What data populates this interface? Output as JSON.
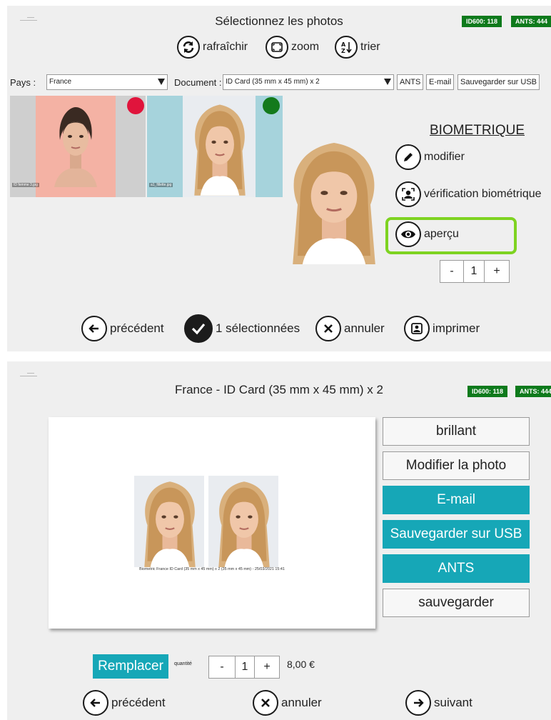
{
  "screen1": {
    "title": "Sélectionnez les photos",
    "badges": [
      "ID600: 118",
      "ANTS: 444"
    ],
    "toolbar": {
      "refresh": "rafraîchir",
      "zoom": "zoom",
      "sort": "trier"
    },
    "country": {
      "label": "Pays :",
      "value": "France"
    },
    "document": {
      "label": "Document :",
      "value": "ID Card (35 mm x 45 mm) x 2"
    },
    "actions": [
      "ANTS",
      "E-mail",
      "Sauvegarder sur USB"
    ],
    "thumbnails": [
      {
        "filename": "ID femme 3.jpg",
        "status_color": "#e0143c"
      },
      {
        "filename": "a1_fillette.jpg",
        "status_color": "#137a1c"
      }
    ],
    "biometric": {
      "title": "BIOMETRIQUE",
      "edit": "modifier",
      "check": "vérification biométrique",
      "preview": "aperçu"
    },
    "quantity": {
      "minus": "-",
      "value": "1",
      "plus": "+"
    },
    "bottom": {
      "previous": "précédent",
      "selected": "1 sélectionnées",
      "cancel": "annuler",
      "print": "imprimer"
    }
  },
  "screen2": {
    "title": "France - ID Card (35 mm x 45 mm) x 2",
    "badges": [
      "ID600: 118",
      "ANTS: 444"
    ],
    "caption": "Biometric France ID Card (35 mm x 45 mm) x 2 (35 mm x 45 mm) - 25/03/2021 15:41",
    "buttons": [
      "brillant",
      "Modifier la photo",
      "E-mail",
      "Sauvegarder sur USB",
      "ANTS",
      "sauvegarder"
    ],
    "replace": "Remplacer",
    "quantity_label": "quantité",
    "quantity": {
      "minus": "-",
      "value": "1",
      "plus": "+"
    },
    "price": "8,00 €",
    "bottom": {
      "previous": "précédent",
      "cancel": "annuler",
      "next": "suivant"
    }
  },
  "colors": {
    "badge_green": "#0e7a1c",
    "highlight_green": "#7ed321",
    "teal": "#16a7b7",
    "thumb1_bg": "#f4b2a4",
    "thumb2_bg": "#a6d3dc"
  },
  "icons": [
    "refresh-icon",
    "zoom-icon",
    "sort-az-icon",
    "pencil-icon",
    "face-scan-icon",
    "eye-icon",
    "arrow-left-icon",
    "check-icon",
    "close-icon",
    "print-icon",
    "arrow-right-icon"
  ]
}
